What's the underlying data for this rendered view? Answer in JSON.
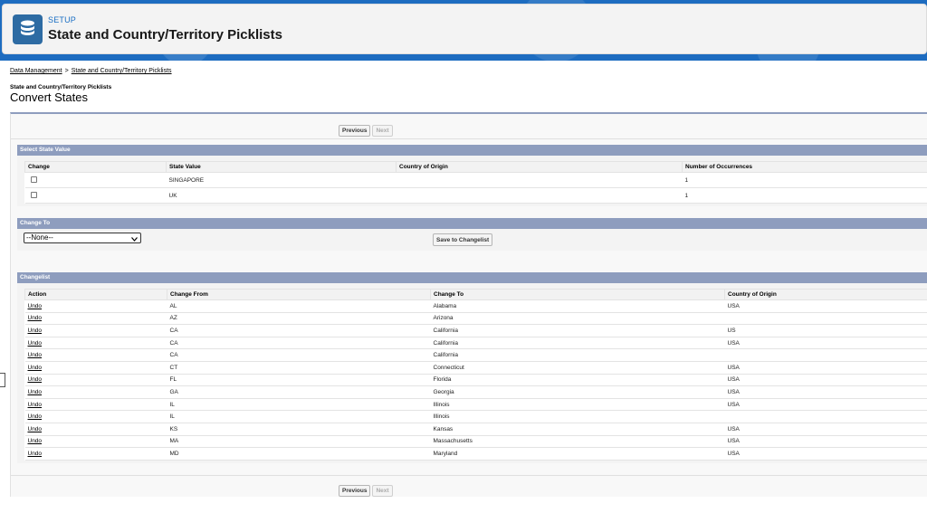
{
  "header": {
    "setup_label": "SETUP",
    "title": "State and Country/Territory Picklists"
  },
  "breadcrumb": {
    "items": [
      "Data Management",
      "State and Country/Territory Picklists"
    ],
    "separator": ">"
  },
  "page": {
    "subtitle": "State and Country/Territory Picklists",
    "title": "Convert States"
  },
  "pager": {
    "previous": "Previous",
    "next": "Next"
  },
  "select_state": {
    "heading": "Select State Value",
    "columns": [
      "Change",
      "State Value",
      "Country of Origin",
      "Number of Occurrences"
    ],
    "rows": [
      {
        "state": "SINGAPORE",
        "country": "",
        "count": "1",
        "checked": false
      },
      {
        "state": "UK",
        "country": "",
        "count": "1",
        "checked": false
      }
    ]
  },
  "change_to": {
    "heading": "Change To",
    "selected": "--None--",
    "save_label": "Save to Changelist"
  },
  "changelist": {
    "heading": "Changelist",
    "columns": [
      "Action",
      "Change From",
      "Change To",
      "Country of Origin"
    ],
    "rows": [
      {
        "action": "Undo",
        "from": "AL",
        "to": "Alabama",
        "country": "USA"
      },
      {
        "action": "Undo",
        "from": "AZ",
        "to": "Arizona",
        "country": ""
      },
      {
        "action": "Undo",
        "from": "CA",
        "to": "California",
        "country": "US"
      },
      {
        "action": "Undo",
        "from": "CA",
        "to": "California",
        "country": "USA"
      },
      {
        "action": "Undo",
        "from": "CA",
        "to": "California",
        "country": ""
      },
      {
        "action": "Undo",
        "from": "CT",
        "to": "Connecticut",
        "country": "USA"
      },
      {
        "action": "Undo",
        "from": "FL",
        "to": "Florida",
        "country": "USA"
      },
      {
        "action": "Undo",
        "from": "GA",
        "to": "Georgia",
        "country": "USA"
      },
      {
        "action": "Undo",
        "from": "IL",
        "to": "Illinois",
        "country": "USA"
      },
      {
        "action": "Undo",
        "from": "IL",
        "to": "Illinois",
        "country": ""
      },
      {
        "action": "Undo",
        "from": "KS",
        "to": "Kansas",
        "country": "USA"
      },
      {
        "action": "Undo",
        "from": "MA",
        "to": "Massachusetts",
        "country": "USA"
      },
      {
        "action": "Undo",
        "from": "MD",
        "to": "Maryland",
        "country": "USA"
      }
    ]
  },
  "colors": {
    "brand": "#1d6cc0",
    "section_bar": "#8e9dbe",
    "icon_bg": "#2d6ba3"
  }
}
